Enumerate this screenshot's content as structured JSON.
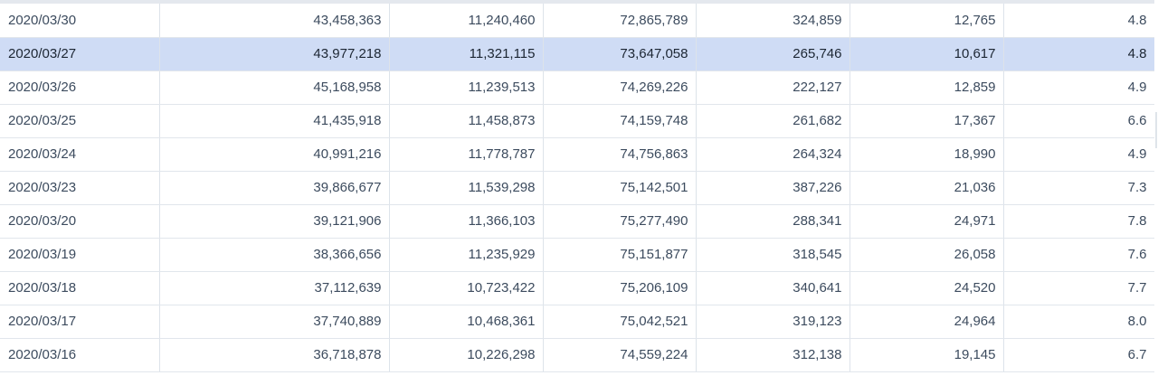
{
  "table": {
    "selected_index": 1,
    "rows": [
      {
        "date": "2020/03/30",
        "c1": "43,458,363",
        "c2": "11,240,460",
        "c3": "72,865,789",
        "c4": "324,859",
        "c5": "12,765",
        "c6": "4.8"
      },
      {
        "date": "2020/03/27",
        "c1": "43,977,218",
        "c2": "11,321,115",
        "c3": "73,647,058",
        "c4": "265,746",
        "c5": "10,617",
        "c6": "4.8"
      },
      {
        "date": "2020/03/26",
        "c1": "45,168,958",
        "c2": "11,239,513",
        "c3": "74,269,226",
        "c4": "222,127",
        "c5": "12,859",
        "c6": "4.9"
      },
      {
        "date": "2020/03/25",
        "c1": "41,435,918",
        "c2": "11,458,873",
        "c3": "74,159,748",
        "c4": "261,682",
        "c5": "17,367",
        "c6": "6.6"
      },
      {
        "date": "2020/03/24",
        "c1": "40,991,216",
        "c2": "11,778,787",
        "c3": "74,756,863",
        "c4": "264,324",
        "c5": "18,990",
        "c6": "4.9"
      },
      {
        "date": "2020/03/23",
        "c1": "39,866,677",
        "c2": "11,539,298",
        "c3": "75,142,501",
        "c4": "387,226",
        "c5": "21,036",
        "c6": "7.3"
      },
      {
        "date": "2020/03/20",
        "c1": "39,121,906",
        "c2": "11,366,103",
        "c3": "75,277,490",
        "c4": "288,341",
        "c5": "24,971",
        "c6": "7.8"
      },
      {
        "date": "2020/03/19",
        "c1": "38,366,656",
        "c2": "11,235,929",
        "c3": "75,151,877",
        "c4": "318,545",
        "c5": "26,058",
        "c6": "7.6"
      },
      {
        "date": "2020/03/18",
        "c1": "37,112,639",
        "c2": "10,723,422",
        "c3": "75,206,109",
        "c4": "340,641",
        "c5": "24,520",
        "c6": "7.7"
      },
      {
        "date": "2020/03/17",
        "c1": "37,740,889",
        "c2": "10,468,361",
        "c3": "75,042,521",
        "c4": "319,123",
        "c5": "24,964",
        "c6": "8.0"
      },
      {
        "date": "2020/03/16",
        "c1": "36,718,878",
        "c2": "10,226,298",
        "c3": "74,559,224",
        "c4": "312,138",
        "c5": "19,145",
        "c6": "6.7"
      }
    ]
  },
  "colors": {
    "selected_row_bg": "#cfdcf5",
    "cell_text": "#3c4b5e",
    "grid_line": "#dde3ea"
  }
}
